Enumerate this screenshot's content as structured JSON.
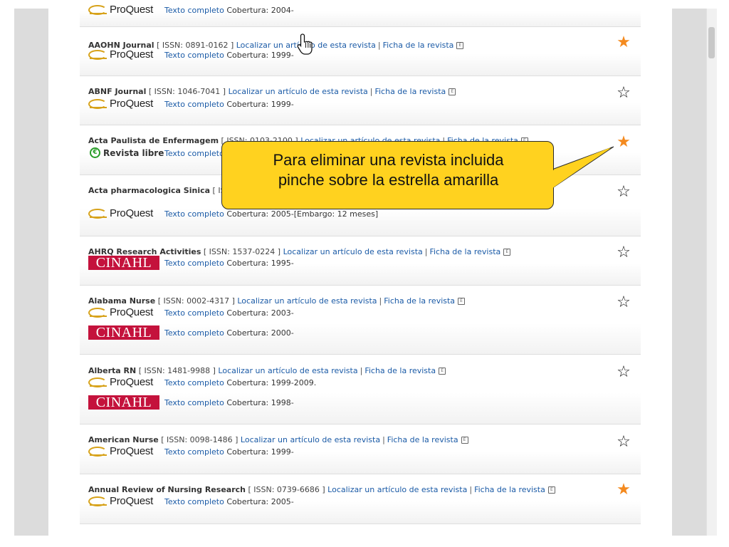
{
  "labels": {
    "locate": "Localizar un artículo de esta revista",
    "record": "Ficha de la revista",
    "fulltext": "Texto completo",
    "separator": "|",
    "ext_icon": "E"
  },
  "sources": {
    "proquest": "ProQuest",
    "cinahl": "CINAHL",
    "libre": "Revista libre"
  },
  "top_partial": {
    "source": "ProQuest",
    "fulltext": "Texto completo",
    "coverage": "Cobertura: 2004-"
  },
  "rows": [
    {
      "name": "AAOHN Journal",
      "issn": "[ ISSN: 0891-0162 ]",
      "starred": true,
      "sources": [
        {
          "type": "proquest",
          "coverage": "Cobertura: 1999-"
        }
      ]
    },
    {
      "name": "ABNF Journal",
      "issn": "[ ISSN: 1046-7041 ]",
      "starred": false,
      "sources": [
        {
          "type": "proquest",
          "coverage": "Cobertura: 1999-"
        }
      ]
    },
    {
      "name": "Acta Paulista de Enfermagem",
      "issn": "[ ISSN: 0103-2100 ]",
      "starred": true,
      "sources": [
        {
          "type": "libre",
          "coverage": "Cobertura:"
        }
      ]
    },
    {
      "name": "Acta pharmacologica Sinica",
      "issn": "[ ISSN: 1671-4083 ]",
      "starred": false,
      "sources": [
        {
          "type": "proquest",
          "coverage": "Cobertura: 2005-[Embargo: 12 meses]"
        }
      ]
    },
    {
      "name": "AHRQ Research Activities",
      "issn": "[ ISSN: 1537-0224 ]",
      "starred": false,
      "sources": [
        {
          "type": "cinahl",
          "coverage": "Cobertura: 1995-"
        }
      ]
    },
    {
      "name": "Alabama Nurse",
      "issn": "[ ISSN: 0002-4317 ]",
      "starred": false,
      "sources": [
        {
          "type": "proquest",
          "coverage": "Cobertura: 2003-"
        },
        {
          "type": "cinahl",
          "coverage": "Cobertura: 2000-"
        }
      ]
    },
    {
      "name": "Alberta RN",
      "issn": "[ ISSN: 1481-9988 ]",
      "starred": false,
      "sources": [
        {
          "type": "proquest",
          "coverage": "Cobertura: 1999-2009."
        },
        {
          "type": "cinahl",
          "coverage": "Cobertura: 1998-"
        }
      ]
    },
    {
      "name": "American Nurse",
      "issn": "[ ISSN: 0098-1486 ]",
      "starred": false,
      "sources": [
        {
          "type": "proquest",
          "coverage": "Cobertura: 1999-"
        }
      ]
    },
    {
      "name": "Annual Review of Nursing Research",
      "issn": "[ ISSN: 0739-6686 ]",
      "starred": true,
      "sources": [
        {
          "type": "proquest",
          "coverage": "Cobertura: 2005-"
        }
      ]
    }
  ],
  "callout": {
    "line1": "Para eliminar una revista incluida",
    "line2": "pinche sobre la estrella amarilla"
  },
  "colors": {
    "star_on": "#f48a1f",
    "link": "#1a5aa6",
    "callout_bg": "#ffd21f",
    "cinahl": "#c4123c"
  },
  "icons": {
    "star_on": "★",
    "star_off": "☆",
    "cursor": "hand-pointer-icon"
  }
}
